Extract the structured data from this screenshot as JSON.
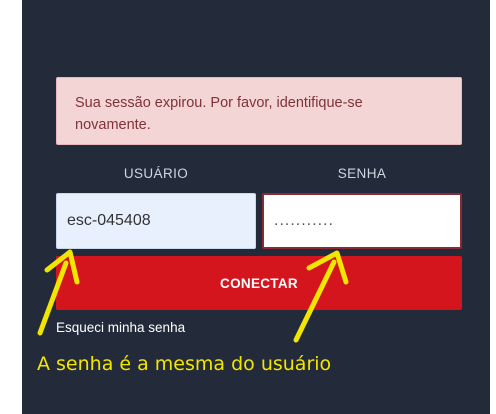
{
  "alert": {
    "message_line1": "Sua sessão expirou. Por favor, identifique-se",
    "message_line2": "novamente."
  },
  "login_form": {
    "username_label": "USUÁRIO",
    "password_label": "SENHA",
    "username_value": "esc-045408",
    "password_masked": "...........",
    "connect_label": "CONECTAR",
    "forgot_password_label": "Esqueci minha senha"
  },
  "annotation": {
    "text": "A senha é a mesma do usuário",
    "color": "#f2e600"
  },
  "colors": {
    "panel_background": "#232b3a",
    "alert_background": "#f3d5d6",
    "alert_text": "#7f3338",
    "button_background": "#d5151e",
    "username_field_background": "#e8f0fe",
    "password_field_border": "#8c2a34"
  }
}
